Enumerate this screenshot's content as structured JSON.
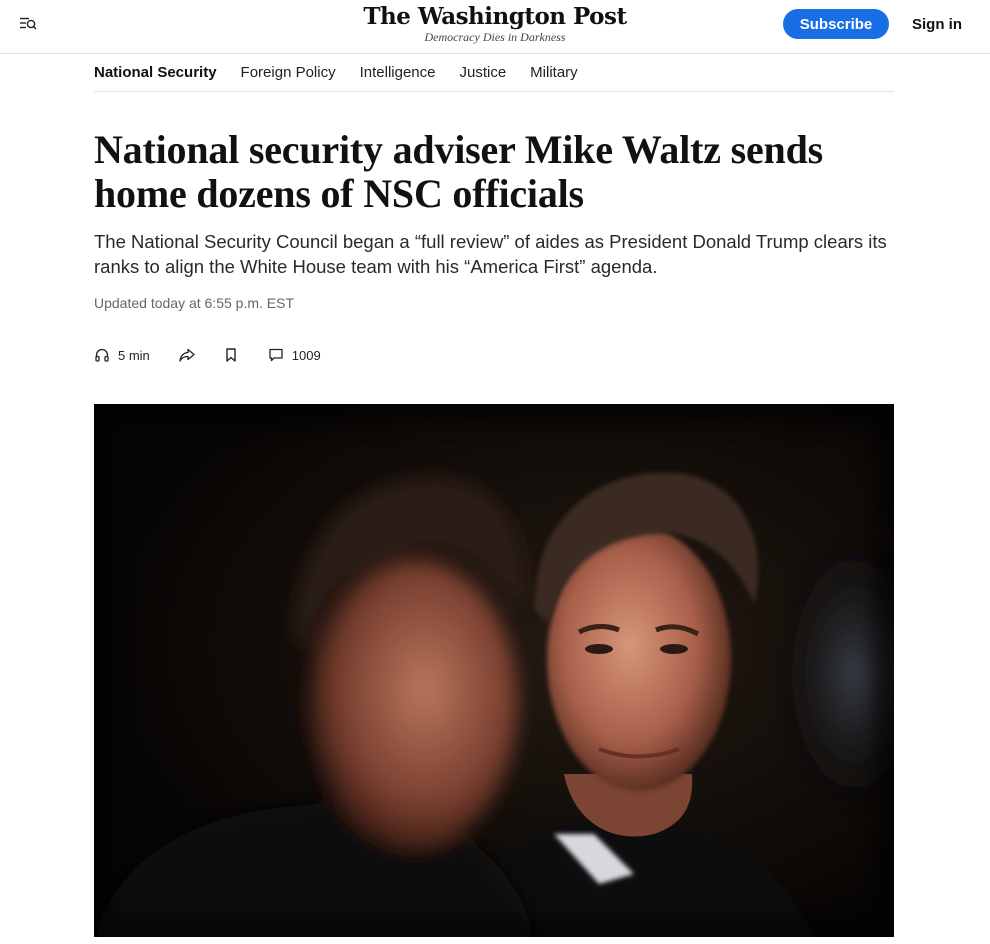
{
  "header": {
    "logo": "The Washington Post",
    "tagline": "Democracy Dies in Darkness",
    "menu_icon": "menu-search-icon",
    "subscribe_label": "Subscribe",
    "signin_label": "Sign in",
    "accent_color": "#1a6ee5"
  },
  "sections": [
    {
      "label": "National Security",
      "active": true
    },
    {
      "label": "Foreign Policy"
    },
    {
      "label": "Intelligence"
    },
    {
      "label": "Justice"
    },
    {
      "label": "Military"
    }
  ],
  "article": {
    "headline": "National security adviser Mike Waltz sends home dozens of NSC officials",
    "dek": "The National Security Council began a “full review” of aides as President Donald Trump clears its ranks to align the White House team with his “America First” agenda.",
    "timestamp": "Updated today at 6:55 p.m. EST",
    "listen": {
      "icon": "headphones-icon",
      "label": "5 min"
    },
    "share_icon": "share-icon",
    "bookmark_icon": "bookmark-icon",
    "comments": {
      "icon": "comment-icon",
      "count": "1009"
    }
  }
}
